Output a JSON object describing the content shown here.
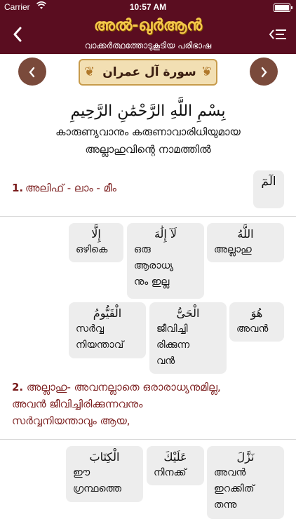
{
  "status_bar": {
    "carrier": "Carrier",
    "time": "10:57 AM"
  },
  "header": {
    "title": "അൽ-ഖുർആൻ",
    "subtitle": "വാക്കർത്ഥത്തോടുകൂടിയ പരിഭാഷ"
  },
  "surah": {
    "name": "سورة آل عمران"
  },
  "bismillah": {
    "arabic": "بِسْمِ اللَّهِ الرَّحْمَٰنِ الرَّحِيمِ",
    "malayalam_line1": "കാരുണ്യവാനും കരുണാവാരിധിയുമായ",
    "malayalam_line2": "അല്ലാഹുവിന്റെ നാമത്തിൽ"
  },
  "ayahs": [
    {
      "number": "1.",
      "text": "അലിഫ് - ലാം - മീം",
      "huruf": "الٓمٓ"
    },
    {
      "number": "2.",
      "line1": "അല്ലാഹു- അവനല്ലാതെ ഒരാരാധ്യനുമില്ല,",
      "line2": "അവൻ ജീവിച്ചിരിക്കുന്നവനും",
      "line3": "സർവ്വനിയന്താവും ആയ,"
    }
  ],
  "words_ayah2": [
    {
      "ar": "اللَّهُ",
      "ml1": "അല്ലാഹു",
      "ml2": "",
      "ml3": ""
    },
    {
      "ar": "لَآ إِلَٰهَ",
      "ml1": "ഒരു",
      "ml2": "ആരാധ്യ",
      "ml3": "നും ഇല്ല"
    },
    {
      "ar": "إِلَّا",
      "ml1": "ഒഴികെ",
      "ml2": "",
      "ml3": ""
    },
    {
      "ar": "هُوَ",
      "ml1": "അവൻ",
      "ml2": "",
      "ml3": ""
    },
    {
      "ar": "الْحَىُّ",
      "ml1": "ജീവിച്ചി",
      "ml2": "രിക്കുന്ന",
      "ml3": "വൻ"
    },
    {
      "ar": "الْقَيُّومُ",
      "ml1": "സർവ്വ",
      "ml2": "നിയന്താവ്",
      "ml3": ""
    }
  ],
  "words_ayah3": [
    {
      "ar": "نَزَّلَ",
      "ml1": "അവൻ",
      "ml2": "ഇറക്കിത്",
      "ml3": "തന്നു"
    },
    {
      "ar": "عَلَيْكَ",
      "ml1": "നിനക്ക്",
      "ml2": "",
      "ml3": ""
    },
    {
      "ar": "الْكِتَابَ",
      "ml1": "ഈ",
      "ml2": "ഗ്രന്ഥത്തെ",
      "ml3": ""
    }
  ],
  "icons": {
    "back": "chevron-left-icon",
    "menu": "list-menu-icon",
    "prev": "chevron-left-icon",
    "next": "chevron-right-icon"
  },
  "colors": {
    "header_bg": "#5a0d20",
    "title_gold": "#f5c84a",
    "nav_circle": "#7a4a3b",
    "verse_text": "#7a1c1c",
    "card_bg": "#ededed"
  }
}
